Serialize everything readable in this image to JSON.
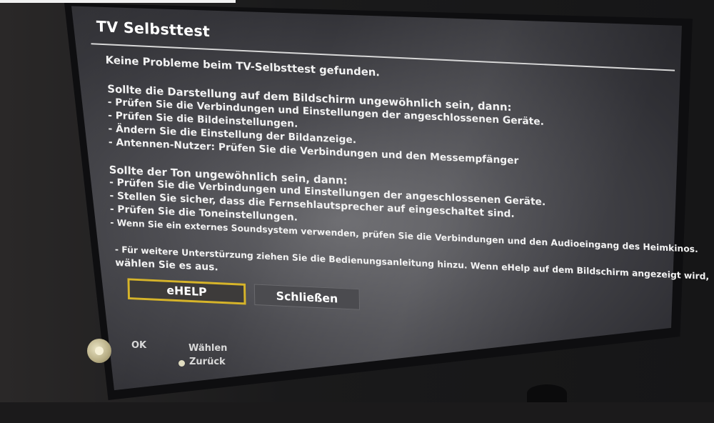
{
  "dialog": {
    "title": "TV Selbsttest",
    "status": "Keine Probleme beim TV-Selbsttest gefunden.",
    "picture": {
      "heading": "Sollte die Darstellung auf dem Bildschirm ungewöhnlich sein, dann:",
      "items": [
        "- Prüfen Sie die Verbindungen und Einstellungen der angeschlossenen Geräte.",
        "- Prüfen Sie die Bildeinstellungen.",
        "- Ändern Sie die Einstellung der Bildanzeige.",
        "- Antennen-Nutzer: Prüfen Sie die Verbindungen und den Messempfänger"
      ]
    },
    "sound": {
      "heading": "Sollte der Ton ungewöhnlich sein, dann:",
      "items": [
        "- Prüfen Sie die Verbindungen und Einstellungen der angeschlossenen Geräte.",
        "- Stellen Sie sicher, dass die Fernsehlautsprecher auf eingeschaltet sind.",
        "- Prüfen Sie die Toneinstellungen.",
        "- Wenn Sie ein externes Soundsystem verwenden, prüfen Sie die Verbindungen und den Audioeingang des Heimkinos."
      ]
    },
    "support": {
      "line1": "- Für weitere Unterstürzung ziehen Sie die Bedienungsanleitung hinzu. Wenn eHelp auf dem Bildschirm angezeigt wird,",
      "line2": "wählen Sie es aus."
    },
    "buttons": {
      "ehelp": "eHELP",
      "close": "Schließen"
    },
    "hints": {
      "ok": "OK",
      "select": "Wählen",
      "back": "Zurück"
    },
    "colors": {
      "focus_border": "#d6b42a",
      "screen_bg": "#4a4a4f"
    }
  }
}
